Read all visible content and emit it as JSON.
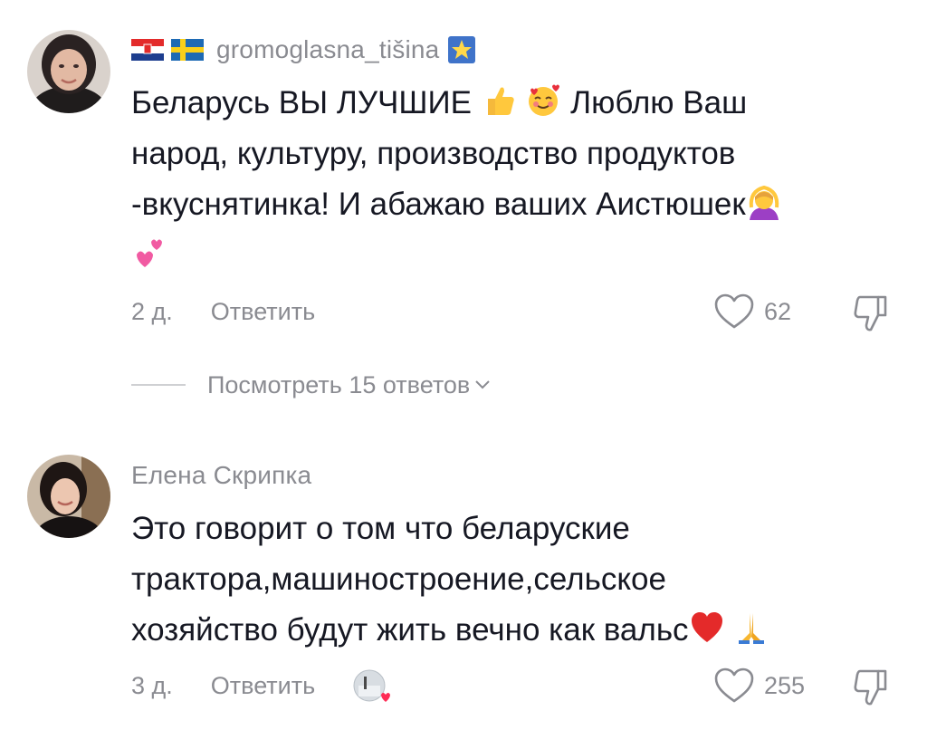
{
  "comments": [
    {
      "username": "gromoglasna_tišina",
      "text_line1": "Беларусь ВЫ ЛУЧШИЕ",
      "text_line1_end": "Люблю Ваш",
      "text_line2": "народ, культуру, производство продуктов",
      "text_line3": "-вкуснятинка! И абажаю ваших Аистюшек",
      "age": "2 д.",
      "reply_label": "Ответить",
      "likes": "62",
      "view_replies": "Посмотреть 15 ответов",
      "icons": [
        "croatia-flag-icon",
        "sweden-flag-icon",
        "glowing-star-icon",
        "thumbs-up-icon",
        "smiling-face-with-hearts-icon",
        "person-gesturing-ok-icon",
        "two-hearts-icon",
        "heart-outline-icon",
        "dislike-icon",
        "chevron-down-icon"
      ]
    },
    {
      "username": "Елена Скрипка",
      "text_line1": "Это говорит о том что беларуские",
      "text_line2": "трактора,машиностроение,сельское",
      "text_line3": "хозяйство будут жить вечно как вальс",
      "age": "3 д.",
      "reply_label": "Ответить",
      "likes": "255",
      "icons": [
        "red-heart-icon",
        "folded-hands-icon",
        "creator-liked-icon",
        "heart-outline-icon",
        "dislike-icon"
      ]
    }
  ]
}
